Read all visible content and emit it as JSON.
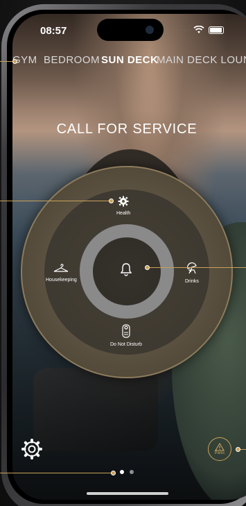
{
  "status_bar": {
    "time": "08:57"
  },
  "tabs": [
    {
      "label": "GYM"
    },
    {
      "label": "BEDROOM"
    },
    {
      "label": "SUN DECK",
      "active": true
    },
    {
      "label": "MAIN DECK LOUN"
    }
  ],
  "title": "CALL FOR SERVICE",
  "services": {
    "health": "Health",
    "housekeeping": "Housekeeping",
    "drinks": "Drinks",
    "do_not_disturb": "Do Not Disturb"
  },
  "panic_label": "Panic",
  "pager": {
    "pages": 2,
    "current": 1
  },
  "colors": {
    "accent_gold": "#c9a25a",
    "ring_gold": "#8c7b5c",
    "text_white": "#ffffff",
    "center_ring_gray": "#8a8a8a"
  },
  "icons": [
    "gear-icon",
    "bell-icon",
    "hanger-icon",
    "beach-chair-icon",
    "door-hanger-icon",
    "warning-icon",
    "wifi-icon",
    "battery-icon"
  ]
}
